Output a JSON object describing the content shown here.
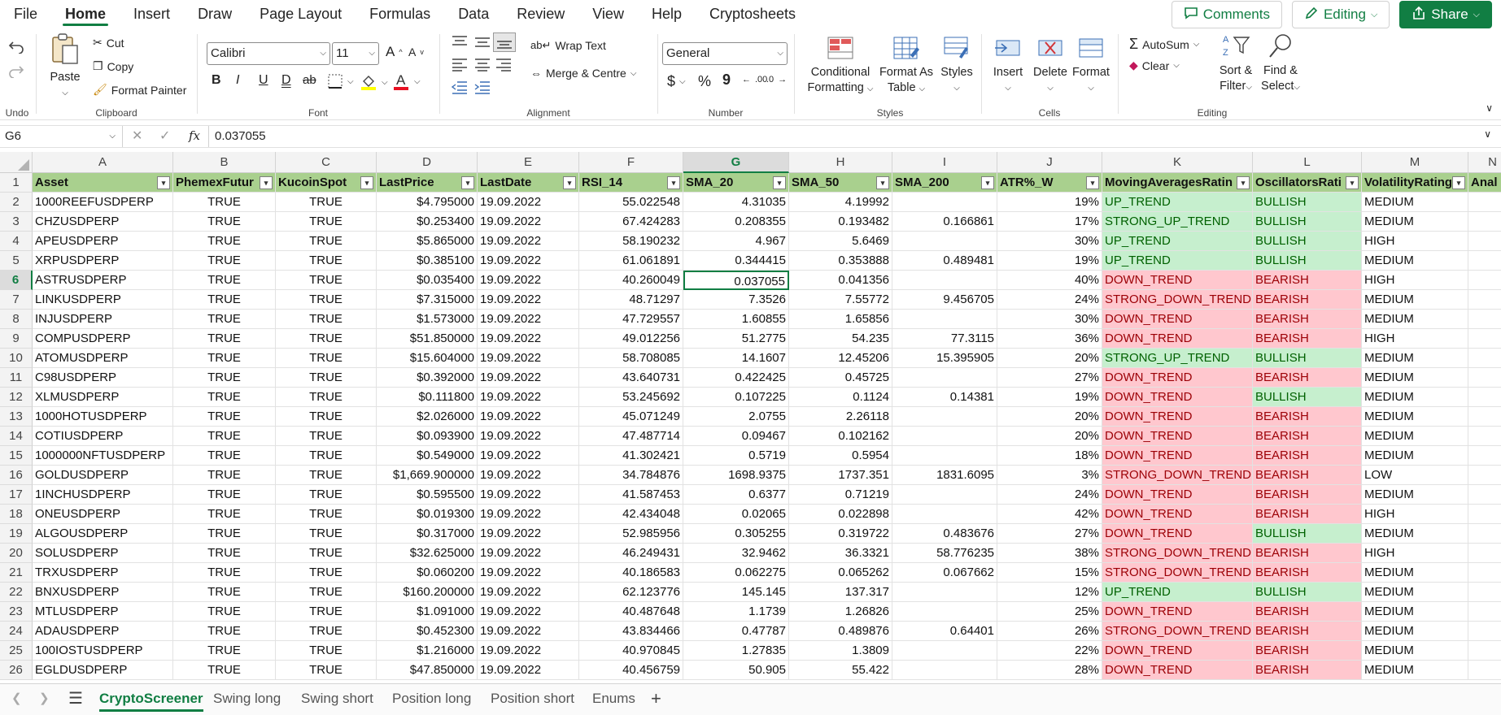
{
  "menu": {
    "items": [
      "File",
      "Home",
      "Insert",
      "Draw",
      "Page Layout",
      "Formulas",
      "Data",
      "Review",
      "View",
      "Help",
      "Cryptosheets"
    ],
    "active_index": 1,
    "comments_label": "Comments",
    "editing_label": "Editing",
    "share_label": "Share"
  },
  "ribbon": {
    "undo_label": "Undo",
    "clipboard": {
      "paste": "Paste",
      "cut": "Cut",
      "copy": "Copy",
      "format_painter": "Format Painter",
      "label": "Clipboard"
    },
    "font": {
      "name": "Calibri",
      "size": "11",
      "bold": "B",
      "italic": "I",
      "underline": "U",
      "double_underline": "D",
      "strike": "ab",
      "label": "Font"
    },
    "alignment": {
      "wrap": "Wrap Text",
      "merge": "Merge & Centre",
      "label": "Alignment"
    },
    "number": {
      "format": "General",
      "currency": "$",
      "percent": "%",
      "comma": "9",
      "inc": ".00",
      "dec": ".0",
      "label": "Number"
    },
    "styles": {
      "conditional": "Conditional",
      "formatting": "Formatting",
      "format_as": "Format As",
      "table": "Table",
      "styles": "Styles",
      "label": "Styles"
    },
    "cells": {
      "insert": "Insert",
      "delete": "Delete",
      "format": "Format",
      "label": "Cells"
    },
    "editing": {
      "autosum": "AutoSum",
      "clear": "Clear",
      "sort": "Sort &",
      "filter": "Filter",
      "find": "Find &",
      "select": "Select",
      "label": "Editing"
    }
  },
  "formula_bar": {
    "name_box": "G6",
    "fx": "fx",
    "formula": "0.037055"
  },
  "columns": [
    "A",
    "B",
    "C",
    "D",
    "E",
    "F",
    "G",
    "H",
    "I",
    "J",
    "K",
    "L",
    "M",
    "N"
  ],
  "selected_column": "G",
  "selected_row": 6,
  "header_row": [
    "Asset",
    "PhemexFutur",
    "KucoinSpot",
    "LastPrice",
    "LastDate",
    "RSI_14",
    "SMA_20",
    "SMA_50",
    "SMA_200",
    "ATR%_W",
    "MovingAveragesRatin",
    "OscillatorsRati",
    "VolatilityRating",
    "Anal"
  ],
  "rows": [
    [
      "1000REEFUSDPERP",
      "TRUE",
      "TRUE",
      "$4.795000",
      "19.09.2022",
      "55.022548",
      "4.31035",
      "4.19992",
      "",
      "19%",
      "UP_TREND",
      "BULLISH",
      "MEDIUM"
    ],
    [
      "CHZUSDPERP",
      "TRUE",
      "TRUE",
      "$0.253400",
      "19.09.2022",
      "67.424283",
      "0.208355",
      "0.193482",
      "0.166861",
      "17%",
      "STRONG_UP_TREND",
      "BULLISH",
      "MEDIUM"
    ],
    [
      "APEUSDPERP",
      "TRUE",
      "TRUE",
      "$5.865000",
      "19.09.2022",
      "58.190232",
      "4.967",
      "5.6469",
      "",
      "30%",
      "UP_TREND",
      "BULLISH",
      "HIGH"
    ],
    [
      "XRPUSDPERP",
      "TRUE",
      "TRUE",
      "$0.385100",
      "19.09.2022",
      "61.061891",
      "0.344415",
      "0.353888",
      "0.489481",
      "19%",
      "UP_TREND",
      "BULLISH",
      "MEDIUM"
    ],
    [
      "ASTRUSDPERP",
      "TRUE",
      "TRUE",
      "$0.035400",
      "19.09.2022",
      "40.260049",
      "0.037055",
      "0.041356",
      "",
      "40%",
      "DOWN_TREND",
      "BEARISH",
      "HIGH"
    ],
    [
      "LINKUSDPERP",
      "TRUE",
      "TRUE",
      "$7.315000",
      "19.09.2022",
      "48.71297",
      "7.3526",
      "7.55772",
      "9.456705",
      "24%",
      "STRONG_DOWN_TREND",
      "BEARISH",
      "MEDIUM"
    ],
    [
      "INJUSDPERP",
      "TRUE",
      "TRUE",
      "$1.573000",
      "19.09.2022",
      "47.729557",
      "1.60855",
      "1.65856",
      "",
      "30%",
      "DOWN_TREND",
      "BEARISH",
      "MEDIUM"
    ],
    [
      "COMPUSDPERP",
      "TRUE",
      "TRUE",
      "$51.850000",
      "19.09.2022",
      "49.012256",
      "51.2775",
      "54.235",
      "77.3115",
      "36%",
      "DOWN_TREND",
      "BEARISH",
      "HIGH"
    ],
    [
      "ATOMUSDPERP",
      "TRUE",
      "TRUE",
      "$15.604000",
      "19.09.2022",
      "58.708085",
      "14.1607",
      "12.45206",
      "15.395905",
      "20%",
      "STRONG_UP_TREND",
      "BULLISH",
      "MEDIUM"
    ],
    [
      "C98USDPERP",
      "TRUE",
      "TRUE",
      "$0.392000",
      "19.09.2022",
      "43.640731",
      "0.422425",
      "0.45725",
      "",
      "27%",
      "DOWN_TREND",
      "BEARISH",
      "MEDIUM"
    ],
    [
      "XLMUSDPERP",
      "TRUE",
      "TRUE",
      "$0.111800",
      "19.09.2022",
      "53.245692",
      "0.107225",
      "0.1124",
      "0.14381",
      "19%",
      "DOWN_TREND",
      "BULLISH",
      "MEDIUM"
    ],
    [
      "1000HOTUSDPERP",
      "TRUE",
      "TRUE",
      "$2.026000",
      "19.09.2022",
      "45.071249",
      "2.0755",
      "2.26118",
      "",
      "20%",
      "DOWN_TREND",
      "BEARISH",
      "MEDIUM"
    ],
    [
      "COTIUSDPERP",
      "TRUE",
      "TRUE",
      "$0.093900",
      "19.09.2022",
      "47.487714",
      "0.09467",
      "0.102162",
      "",
      "20%",
      "DOWN_TREND",
      "BEARISH",
      "MEDIUM"
    ],
    [
      "1000000NFTUSDPERP",
      "TRUE",
      "TRUE",
      "$0.549000",
      "19.09.2022",
      "41.302421",
      "0.5719",
      "0.5954",
      "",
      "18%",
      "DOWN_TREND",
      "BEARISH",
      "MEDIUM"
    ],
    [
      "GOLDUSDPERP",
      "TRUE",
      "TRUE",
      "$1,669.900000",
      "19.09.2022",
      "34.784876",
      "1698.9375",
      "1737.351",
      "1831.6095",
      "3%",
      "STRONG_DOWN_TREND",
      "BEARISH",
      "LOW"
    ],
    [
      "1INCHUSDPERP",
      "TRUE",
      "TRUE",
      "$0.595500",
      "19.09.2022",
      "41.587453",
      "0.6377",
      "0.71219",
      "",
      "24%",
      "DOWN_TREND",
      "BEARISH",
      "MEDIUM"
    ],
    [
      "ONEUSDPERP",
      "TRUE",
      "TRUE",
      "$0.019300",
      "19.09.2022",
      "42.434048",
      "0.02065",
      "0.022898",
      "",
      "42%",
      "DOWN_TREND",
      "BEARISH",
      "HIGH"
    ],
    [
      "ALGOUSDPERP",
      "TRUE",
      "TRUE",
      "$0.317000",
      "19.09.2022",
      "52.985956",
      "0.305255",
      "0.319722",
      "0.483676",
      "27%",
      "DOWN_TREND",
      "BULLISH",
      "MEDIUM"
    ],
    [
      "SOLUSDPERP",
      "TRUE",
      "TRUE",
      "$32.625000",
      "19.09.2022",
      "46.249431",
      "32.9462",
      "36.3321",
      "58.776235",
      "38%",
      "STRONG_DOWN_TREND",
      "BEARISH",
      "HIGH"
    ],
    [
      "TRXUSDPERP",
      "TRUE",
      "TRUE",
      "$0.060200",
      "19.09.2022",
      "40.186583",
      "0.062275",
      "0.065262",
      "0.067662",
      "15%",
      "STRONG_DOWN_TREND",
      "BEARISH",
      "MEDIUM"
    ],
    [
      "BNXUSDPERP",
      "TRUE",
      "TRUE",
      "$160.200000",
      "19.09.2022",
      "62.123776",
      "145.145",
      "137.317",
      "",
      "12%",
      "UP_TREND",
      "BULLISH",
      "MEDIUM"
    ],
    [
      "MTLUSDPERP",
      "TRUE",
      "TRUE",
      "$1.091000",
      "19.09.2022",
      "40.487648",
      "1.1739",
      "1.26826",
      "",
      "25%",
      "DOWN_TREND",
      "BEARISH",
      "MEDIUM"
    ],
    [
      "ADAUSDPERP",
      "TRUE",
      "TRUE",
      "$0.452300",
      "19.09.2022",
      "43.834466",
      "0.47787",
      "0.489876",
      "0.64401",
      "26%",
      "STRONG_DOWN_TREND",
      "BEARISH",
      "MEDIUM"
    ],
    [
      "100IOSTUSDPERP",
      "TRUE",
      "TRUE",
      "$1.216000",
      "19.09.2022",
      "40.970845",
      "1.27835",
      "1.3809",
      "",
      "22%",
      "DOWN_TREND",
      "BEARISH",
      "MEDIUM"
    ],
    [
      "EGLDUSDPERP",
      "TRUE",
      "TRUE",
      "$47.850000",
      "19.09.2022",
      "40.456759",
      "50.905",
      "55.422",
      "",
      "28%",
      "DOWN_TREND",
      "BEARISH",
      "MEDIUM"
    ]
  ],
  "sheet_tabs": [
    "CryptoScreener",
    "Swing long",
    "Swing short",
    "Position long",
    "Position short",
    "Enums"
  ],
  "active_sheet": 0,
  "colors": {
    "accent": "#117e43",
    "header_fill": "#a9d08e",
    "bull_fill": "#c6efce",
    "bull_text": "#006100",
    "bear_fill": "#ffc7ce",
    "bear_text": "#9c0006"
  }
}
